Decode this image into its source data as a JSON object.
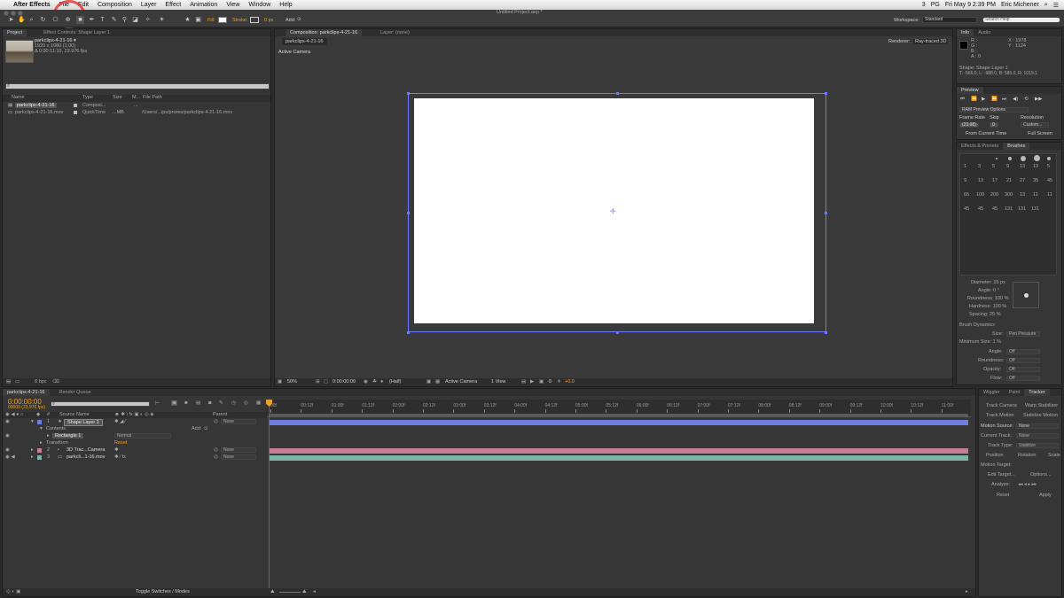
{
  "menubar": {
    "apple": "",
    "app_name": "After Effects",
    "items": [
      "File",
      "Edit",
      "Composition",
      "Layer",
      "Effect",
      "Animation",
      "View",
      "Window",
      "Help"
    ],
    "status": {
      "battery": "3",
      "input": "PG",
      "datetime": "Fri May 9  2:39 PM",
      "user": "Eric Michener"
    }
  },
  "window": {
    "title": "Untitled Project.aep *"
  },
  "toolbar": {
    "fill_label": "Fill:",
    "stroke_label": "Stroke:",
    "stroke_px": "0 px",
    "add_label": "Add:",
    "workspace_label": "Workspace:",
    "workspace_value": "Standard",
    "search_placeholder": "Search Help"
  },
  "project": {
    "tabs": [
      "Project",
      "Effect Controls: Shape Layer 1"
    ],
    "thumb_name": "parkclips-4-21-16 ▾",
    "thumb_info1": "1920 x 1080 (1.00)",
    "thumb_info2": "Δ 0;00:11:10, 23.976 fps",
    "search_value": "",
    "columns": [
      "Name",
      "Type",
      "Size",
      "M...",
      "File Path"
    ],
    "items": [
      {
        "name": "parkclips-4-21-16",
        "type": "Composi...",
        "size": "",
        "path": "..."
      },
      {
        "name": "parkclips-4-21-16.mov",
        "type": "QuickTime",
        "size": "...MB",
        "path": "/Users/...ips/prores/parkclips-4-21-16.mov"
      }
    ],
    "bpc": "8 bpc"
  },
  "composition": {
    "tab": "Composition: parkclips-4-21-16",
    "layer_tab": "Layer: (none)",
    "sub_tab": "parkclips-4-21-16",
    "renderer_label": "Renderer:",
    "renderer_value": "Ray-traced 3D",
    "view_label": "Active Camera",
    "zoom": "50%",
    "timecode": "0:00:00:00",
    "resolution": "(Half)",
    "camera": "Active Camera",
    "views": "1 View",
    "exposure": "+0.0"
  },
  "info": {
    "tabs": [
      "Info",
      "Audio"
    ],
    "r": "R :",
    "g": "G :",
    "b": "B :",
    "a": "A : 0",
    "x": "X : 1978",
    "y": "Y : 1124",
    "layer": "Shape: Shape Layer 1",
    "bounds": "T: -566.0, L: -988.0, B: 585.0, R: 1019.1"
  },
  "preview": {
    "tab": "Preview",
    "ram_options": "RAM Preview Options",
    "frame_rate_label": "Frame Rate",
    "skip_label": "Skip",
    "resolution_label": "Resolution",
    "frame_rate_value": "(23.98)",
    "skip_value": "0",
    "resolution_value": "Custom...",
    "from_current": "From Current Time",
    "full_screen": "Full Screen"
  },
  "brushes": {
    "tabs": [
      "Effects & Presets",
      "Brushes"
    ],
    "sizes_row1": [
      "1",
      "3",
      "5",
      "9",
      "13",
      "19",
      "5"
    ],
    "sizes_row2": [
      "9",
      "13",
      "17",
      "21",
      "27",
      "35",
      "45"
    ],
    "sizes_row3": [
      "65",
      "100",
      "200",
      "300",
      "13",
      "11",
      "11"
    ],
    "sizes_row4": [
      "45",
      "45",
      "45",
      "131",
      "131",
      "131",
      ""
    ],
    "diameter": "Diameter: 15 px",
    "angle": "Angle: 0 °",
    "roundness": "Roundness: 100 %",
    "hardness": "Hardness: 100 %",
    "spacing": "Spacing: 25 %",
    "dynamics": "Brush Dynamics",
    "size_label": "Size:",
    "size_value": "Pen Pressure",
    "min_size": "Minimum Size: 1 %",
    "angle2_label": "Angle:",
    "roundness2_label": "Roundness:",
    "opacity_label": "Opacity:",
    "flow_label": "Flow:",
    "off": "Off"
  },
  "tracker": {
    "tabs": [
      "Wiggler",
      "Paint",
      "Tracker"
    ],
    "track_camera": "Track Camera",
    "warp_stabilizer": "Warp Stabilizer",
    "track_motion": "Track Motion",
    "stabilize_motion": "Stabilize Motion",
    "motion_source_label": "Motion Source:",
    "motion_source_value": "None",
    "current_track_label": "Current Track:",
    "current_track_value": "None",
    "track_type_label": "Track Type:",
    "track_type_value": "Stabilize",
    "position": "Position",
    "rotation": "Rotation",
    "scale": "Scale",
    "motion_target": "Motion Target:",
    "edit_target": "Edit Target...",
    "options": "Options...",
    "analyze": "Analyze:",
    "reset": "Reset",
    "apply": "Apply"
  },
  "timeline": {
    "tabs": [
      "parkclips-4-21-16",
      "Render Queue"
    ],
    "timecode": "0:00:00:00",
    "fps": "00000 (23.976 fps)",
    "col_source": "Source Name",
    "col_parent": "Parent",
    "ruler": [
      "00f",
      "00:12f",
      "01:00f",
      "01:12f",
      "02:00f",
      "02:12f",
      "03:00f",
      "03:12f",
      "04:00f",
      "04:12f",
      "05:00f",
      "05:12f",
      "06:00f",
      "06:12f",
      "07:00f",
      "07:12f",
      "08:00f",
      "08:12f",
      "09:00f",
      "09:12f",
      "10:00f",
      "10:12f",
      "11:00f"
    ],
    "layers": [
      {
        "num": "1",
        "name": "Shape Layer 1",
        "parent": "None",
        "color": "#6f7fe0"
      },
      {
        "num": "2",
        "name": "3D Trac...Camera",
        "parent": "None",
        "color": "#c77d94"
      },
      {
        "num": "3",
        "name": "parkcli...1-16.mov",
        "parent": "None",
        "color": "#7fb2a8"
      }
    ],
    "contents": "Contents",
    "add": "Add:",
    "rectangle": "Rectangle 1",
    "mode": "Normal",
    "transform": "Transform",
    "reset": "Reset",
    "toggle": "Toggle Switches / Modes"
  },
  "colors": {
    "accent": "#f0a020",
    "layer_blue": "#6f7fe0",
    "layer_pink": "#c77d94",
    "layer_teal": "#7fb2a8",
    "highlight_circle": "#e23a3a"
  }
}
